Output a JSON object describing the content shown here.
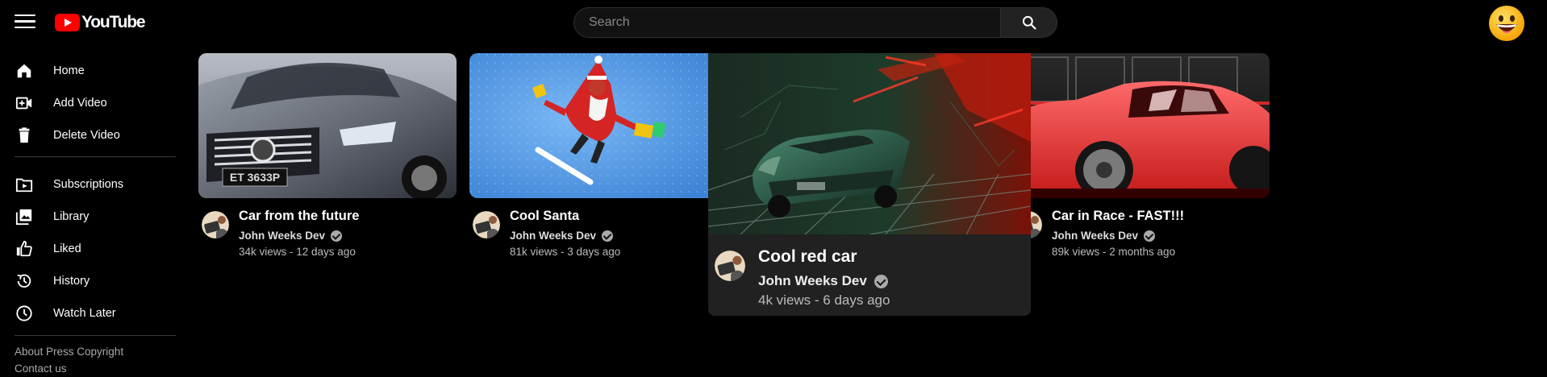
{
  "app": {
    "logo_text": "YouTube"
  },
  "search": {
    "placeholder": "Search",
    "value": ""
  },
  "icons": {
    "menu": "hamburger-menu-icon",
    "search": "search-icon",
    "profile": "smiley-face-icon",
    "verified": "verified-check-icon"
  },
  "sidebar": {
    "main_items": [
      {
        "label": "Home",
        "icon": "home-icon"
      },
      {
        "label": "Add Video",
        "icon": "add-video-icon"
      },
      {
        "label": "Delete Video",
        "icon": "trash-icon"
      }
    ],
    "library_items": [
      {
        "label": "Subscriptions",
        "icon": "subscriptions-icon"
      },
      {
        "label": "Library",
        "icon": "library-icon"
      },
      {
        "label": "Liked",
        "icon": "thumbs-up-icon"
      },
      {
        "label": "History",
        "icon": "history-icon"
      },
      {
        "label": "Watch Later",
        "icon": "clock-icon"
      }
    ],
    "footer": {
      "line1": "About Press Copyright",
      "line2": "Contact us"
    }
  },
  "videos": [
    {
      "title": "Car from the future",
      "channel": "John Weeks Dev",
      "stats": "34k views - 12 days ago",
      "thumbnail": "silver-mercedes-car"
    },
    {
      "title": "Cool Santa",
      "channel": "John Weeks Dev",
      "stats": "81k views - 3 days ago",
      "thumbnail": "snowboarding-santa"
    },
    {
      "title": "Cool red car",
      "channel": "John Weeks Dev",
      "stats": "4k views - 6 days ago",
      "thumbnail": "retro-sports-car-neon",
      "hovered": true
    },
    {
      "title": "Car in Race - FAST!!!",
      "channel": "John Weeks Dev",
      "stats": "89k views - 2 months ago",
      "thumbnail": "red-sedan"
    }
  ],
  "colors": {
    "brand_red": "#ff0000",
    "background": "#000000",
    "hover_card": "#212121"
  }
}
